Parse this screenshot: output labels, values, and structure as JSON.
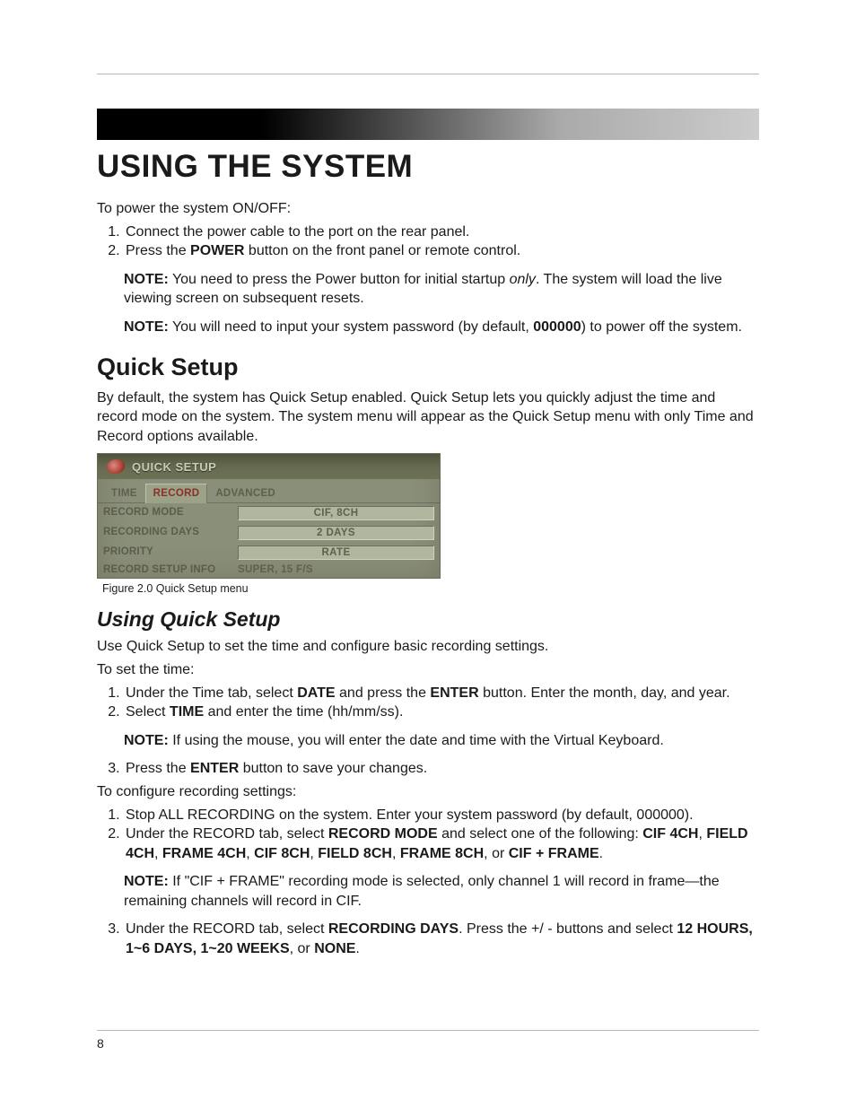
{
  "page_number": "8",
  "banner_title": "USING THE SYSTEM",
  "intro": "To power the system ON/OFF:",
  "power_steps": {
    "s1": "Connect the power cable to the port on the rear panel.",
    "s2_pre": "Press the ",
    "s2_bold": "POWER",
    "s2_post": " button on the front panel or remote control."
  },
  "note1": {
    "label": "NOTE:",
    "pre": " You need to press the Power button for initial startup ",
    "ital": "only",
    "post": ". The system will load the live viewing screen on subsequent resets."
  },
  "note2": {
    "label": "NOTE:",
    "pre": " You will need to input your system password (by default, ",
    "bold": "000000",
    "post": ") to power off the system."
  },
  "quick_setup": {
    "heading": "Quick Setup",
    "para": "By default, the system has Quick Setup enabled. Quick Setup lets you quickly adjust the time and record mode on the system. The system menu will appear as the Quick Setup menu with only Time and Record options available."
  },
  "figure": {
    "title": "QUICK SETUP",
    "tabs": {
      "time": "TIME",
      "record": "RECORD",
      "advanced": "ADVANCED"
    },
    "rows": {
      "record_mode_label": "RECORD MODE",
      "record_mode_value": "CIF, 8CH",
      "recording_days_label": "RECORDING DAYS",
      "recording_days_value": "2 DAYS",
      "priority_label": "PRIORITY",
      "priority_value": "RATE",
      "record_setup_info_label": "RECORD SETUP INFO",
      "record_setup_info_value": "SUPER, 15 F/S"
    },
    "caption": "Figure 2.0 Quick Setup menu"
  },
  "using_quick_setup": {
    "heading": "Using Quick Setup",
    "para": "Use Quick Setup to set the time and configure basic recording settings.",
    "set_time_label": "To set the time:",
    "t1_pre": "Under the Time tab, select ",
    "t1_b1": "DATE",
    "t1_mid": " and press the ",
    "t1_b2": "ENTER",
    "t1_post": " button. Enter the month, day, and year.",
    "t2_pre": "Select ",
    "t2_b": "TIME",
    "t2_post": " and enter the time (hh/mm/ss).",
    "t_note_label": "NOTE:",
    "t_note": " If using the mouse, you will enter the date and time with the Virtual Keyboard.",
    "t3_pre": "Press the ",
    "t3_b": "ENTER",
    "t3_post": " button to save your changes.",
    "rec_label": "To configure recording settings:",
    "r1": "Stop ALL RECORDING on the system. Enter your system password (by default, 000000).",
    "r2_pre": "Under the RECORD tab, select ",
    "r2_b0": "RECORD MODE",
    "r2_mid": " and select one of the following: ",
    "r2_b1": "CIF 4CH",
    "r2_b2": "FIELD 4CH",
    "r2_b3": "FRAME 4CH",
    "r2_b4": "CIF 8CH",
    "r2_b5": "FIELD 8CH",
    "r2_b6": "FRAME 8CH",
    "r2_or": ", or ",
    "r2_b7": "CIF + FRAME",
    "r_note_label": "NOTE:",
    "r_note": " If \"CIF + FRAME\" recording mode is selected, only channel 1 will record in frame—the remaining channels will record in CIF.",
    "r3_pre": "Under the RECORD tab, select ",
    "r3_b0": "RECORDING DAYS",
    "r3_mid": ". Press the +/ - buttons and select ",
    "r3_b1": "12 HOURS, 1~6 DAYS, 1~20 WEEKS",
    "r3_or": ", or ",
    "r3_b2": "NONE",
    "period": "."
  }
}
